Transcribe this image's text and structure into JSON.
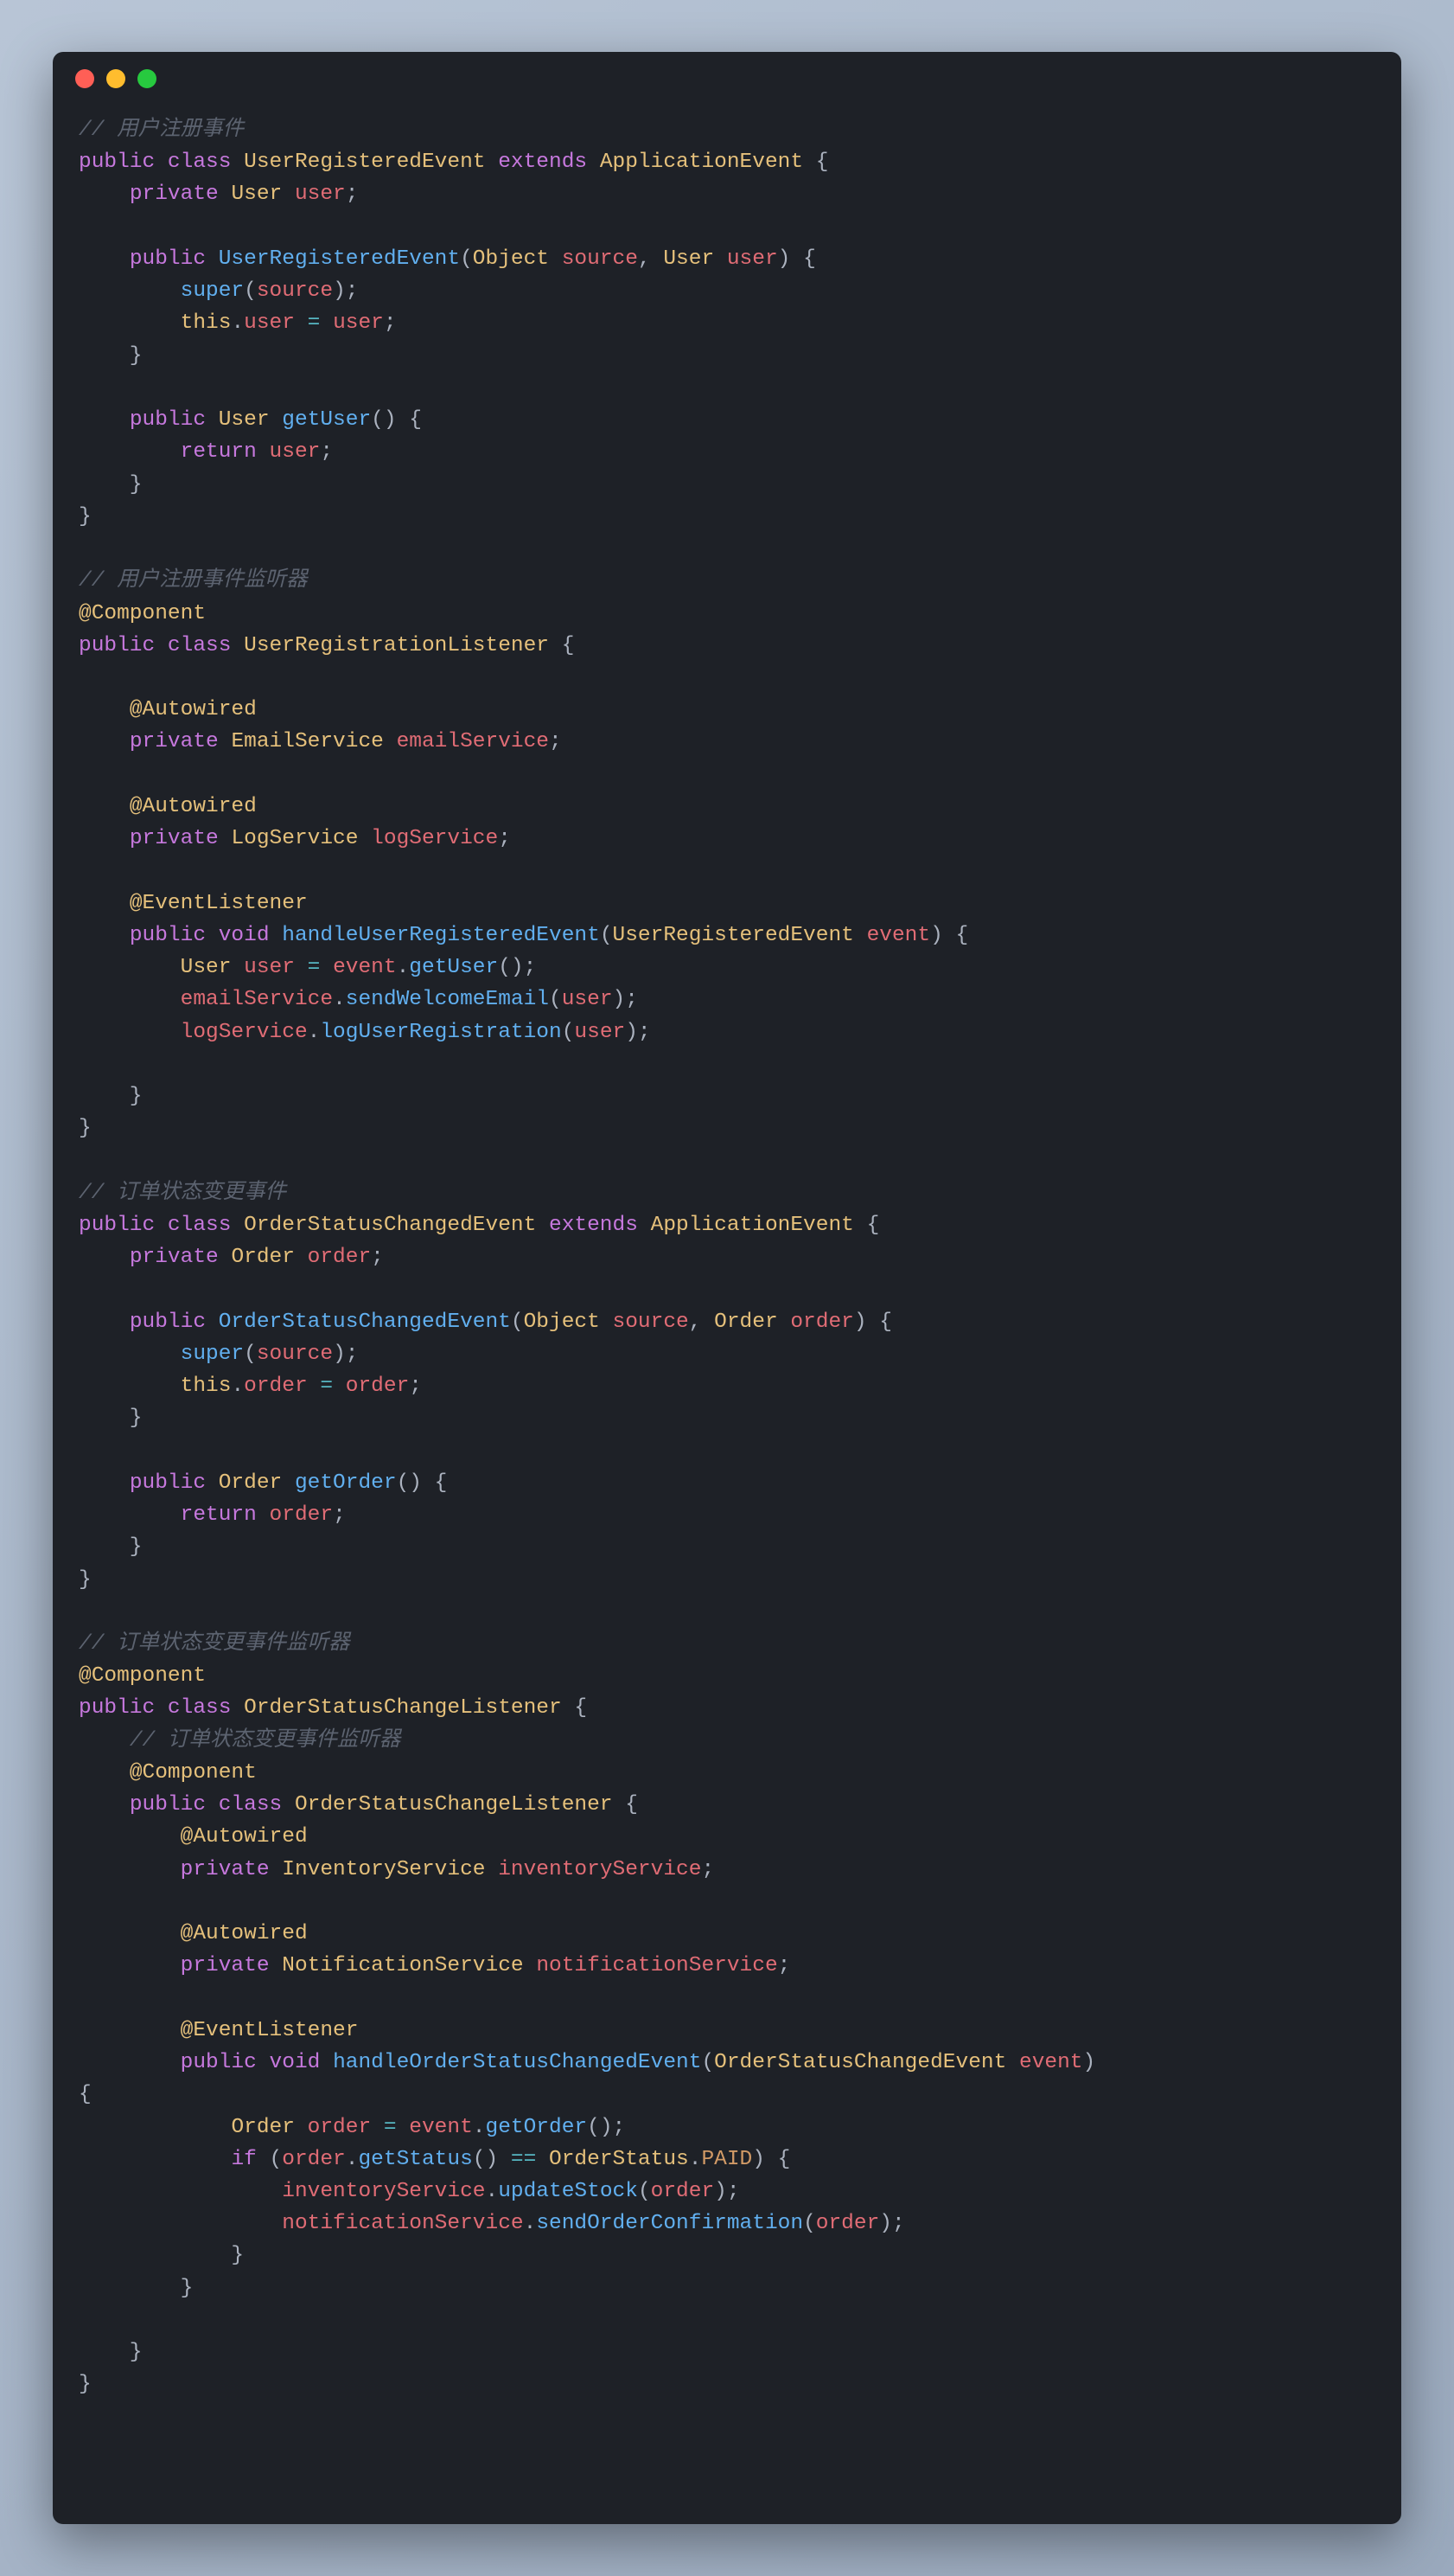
{
  "window": {
    "traffic_lights": [
      "red",
      "yellow",
      "green"
    ]
  },
  "code": {
    "lines": [
      [
        [
          "c-comment",
          "// 用户注册事件"
        ]
      ],
      [
        [
          "c-keyword",
          "public"
        ],
        [
          "c-plain",
          " "
        ],
        [
          "c-keyword",
          "class"
        ],
        [
          "c-plain",
          " "
        ],
        [
          "c-type",
          "UserRegisteredEvent"
        ],
        [
          "c-plain",
          " "
        ],
        [
          "c-keyword",
          "extends"
        ],
        [
          "c-plain",
          " "
        ],
        [
          "c-type",
          "ApplicationEvent"
        ],
        [
          "c-plain",
          " {"
        ]
      ],
      [
        [
          "c-plain",
          "    "
        ],
        [
          "c-keyword",
          "private"
        ],
        [
          "c-plain",
          " "
        ],
        [
          "c-type",
          "User"
        ],
        [
          "c-plain",
          " "
        ],
        [
          "c-var",
          "user"
        ],
        [
          "c-plain",
          ";"
        ]
      ],
      [
        [
          "c-plain",
          ""
        ]
      ],
      [
        [
          "c-plain",
          "    "
        ],
        [
          "c-keyword",
          "public"
        ],
        [
          "c-plain",
          " "
        ],
        [
          "c-method",
          "UserRegisteredEvent"
        ],
        [
          "c-plain",
          "("
        ],
        [
          "c-type",
          "Object"
        ],
        [
          "c-plain",
          " "
        ],
        [
          "c-var",
          "source"
        ],
        [
          "c-plain",
          ", "
        ],
        [
          "c-type",
          "User"
        ],
        [
          "c-plain",
          " "
        ],
        [
          "c-var",
          "user"
        ],
        [
          "c-plain",
          ") {"
        ]
      ],
      [
        [
          "c-plain",
          "        "
        ],
        [
          "c-method",
          "super"
        ],
        [
          "c-plain",
          "("
        ],
        [
          "c-var",
          "source"
        ],
        [
          "c-plain",
          ");"
        ]
      ],
      [
        [
          "c-plain",
          "        "
        ],
        [
          "c-this",
          "this"
        ],
        [
          "c-plain",
          "."
        ],
        [
          "c-var",
          "user"
        ],
        [
          "c-plain",
          " "
        ],
        [
          "c-op",
          "="
        ],
        [
          "c-plain",
          " "
        ],
        [
          "c-var",
          "user"
        ],
        [
          "c-plain",
          ";"
        ]
      ],
      [
        [
          "c-plain",
          "    }"
        ]
      ],
      [
        [
          "c-plain",
          ""
        ]
      ],
      [
        [
          "c-plain",
          "    "
        ],
        [
          "c-keyword",
          "public"
        ],
        [
          "c-plain",
          " "
        ],
        [
          "c-type",
          "User"
        ],
        [
          "c-plain",
          " "
        ],
        [
          "c-method",
          "getUser"
        ],
        [
          "c-plain",
          "() {"
        ]
      ],
      [
        [
          "c-plain",
          "        "
        ],
        [
          "c-keyword",
          "return"
        ],
        [
          "c-plain",
          " "
        ],
        [
          "c-var",
          "user"
        ],
        [
          "c-plain",
          ";"
        ]
      ],
      [
        [
          "c-plain",
          "    }"
        ]
      ],
      [
        [
          "c-plain",
          "}"
        ]
      ],
      [
        [
          "c-plain",
          ""
        ]
      ],
      [
        [
          "c-comment",
          "// 用户注册事件监听器"
        ]
      ],
      [
        [
          "c-ann",
          "@Component"
        ]
      ],
      [
        [
          "c-keyword",
          "public"
        ],
        [
          "c-plain",
          " "
        ],
        [
          "c-keyword",
          "class"
        ],
        [
          "c-plain",
          " "
        ],
        [
          "c-type",
          "UserRegistrationListener"
        ],
        [
          "c-plain",
          " {"
        ]
      ],
      [
        [
          "c-plain",
          ""
        ]
      ],
      [
        [
          "c-plain",
          "    "
        ],
        [
          "c-ann",
          "@Autowired"
        ]
      ],
      [
        [
          "c-plain",
          "    "
        ],
        [
          "c-keyword",
          "private"
        ],
        [
          "c-plain",
          " "
        ],
        [
          "c-type",
          "EmailService"
        ],
        [
          "c-plain",
          " "
        ],
        [
          "c-var",
          "emailService"
        ],
        [
          "c-plain",
          ";"
        ]
      ],
      [
        [
          "c-plain",
          ""
        ]
      ],
      [
        [
          "c-plain",
          "    "
        ],
        [
          "c-ann",
          "@Autowired"
        ]
      ],
      [
        [
          "c-plain",
          "    "
        ],
        [
          "c-keyword",
          "private"
        ],
        [
          "c-plain",
          " "
        ],
        [
          "c-type",
          "LogService"
        ],
        [
          "c-plain",
          " "
        ],
        [
          "c-var",
          "logService"
        ],
        [
          "c-plain",
          ";"
        ]
      ],
      [
        [
          "c-plain",
          ""
        ]
      ],
      [
        [
          "c-plain",
          "    "
        ],
        [
          "c-ann",
          "@EventListener"
        ]
      ],
      [
        [
          "c-plain",
          "    "
        ],
        [
          "c-keyword",
          "public"
        ],
        [
          "c-plain",
          " "
        ],
        [
          "c-keyword",
          "void"
        ],
        [
          "c-plain",
          " "
        ],
        [
          "c-method",
          "handleUserRegisteredEvent"
        ],
        [
          "c-plain",
          "("
        ],
        [
          "c-type",
          "UserRegisteredEvent"
        ],
        [
          "c-plain",
          " "
        ],
        [
          "c-var",
          "event"
        ],
        [
          "c-plain",
          ") {"
        ]
      ],
      [
        [
          "c-plain",
          "        "
        ],
        [
          "c-type",
          "User"
        ],
        [
          "c-plain",
          " "
        ],
        [
          "c-var",
          "user"
        ],
        [
          "c-plain",
          " "
        ],
        [
          "c-op",
          "="
        ],
        [
          "c-plain",
          " "
        ],
        [
          "c-var",
          "event"
        ],
        [
          "c-plain",
          "."
        ],
        [
          "c-method",
          "getUser"
        ],
        [
          "c-plain",
          "();"
        ]
      ],
      [
        [
          "c-plain",
          "        "
        ],
        [
          "c-var",
          "emailService"
        ],
        [
          "c-plain",
          "."
        ],
        [
          "c-method",
          "sendWelcomeEmail"
        ],
        [
          "c-plain",
          "("
        ],
        [
          "c-var",
          "user"
        ],
        [
          "c-plain",
          ");"
        ]
      ],
      [
        [
          "c-plain",
          "        "
        ],
        [
          "c-var",
          "logService"
        ],
        [
          "c-plain",
          "."
        ],
        [
          "c-method",
          "logUserRegistration"
        ],
        [
          "c-plain",
          "("
        ],
        [
          "c-var",
          "user"
        ],
        [
          "c-plain",
          ");"
        ]
      ],
      [
        [
          "c-plain",
          ""
        ]
      ],
      [
        [
          "c-plain",
          "    }"
        ]
      ],
      [
        [
          "c-plain",
          "}"
        ]
      ],
      [
        [
          "c-plain",
          ""
        ]
      ],
      [
        [
          "c-comment",
          "// 订单状态变更事件"
        ]
      ],
      [
        [
          "c-keyword",
          "public"
        ],
        [
          "c-plain",
          " "
        ],
        [
          "c-keyword",
          "class"
        ],
        [
          "c-plain",
          " "
        ],
        [
          "c-type",
          "OrderStatusChangedEvent"
        ],
        [
          "c-plain",
          " "
        ],
        [
          "c-keyword",
          "extends"
        ],
        [
          "c-plain",
          " "
        ],
        [
          "c-type",
          "ApplicationEvent"
        ],
        [
          "c-plain",
          " {"
        ]
      ],
      [
        [
          "c-plain",
          "    "
        ],
        [
          "c-keyword",
          "private"
        ],
        [
          "c-plain",
          " "
        ],
        [
          "c-type",
          "Order"
        ],
        [
          "c-plain",
          " "
        ],
        [
          "c-var",
          "order"
        ],
        [
          "c-plain",
          ";"
        ]
      ],
      [
        [
          "c-plain",
          ""
        ]
      ],
      [
        [
          "c-plain",
          "    "
        ],
        [
          "c-keyword",
          "public"
        ],
        [
          "c-plain",
          " "
        ],
        [
          "c-method",
          "OrderStatusChangedEvent"
        ],
        [
          "c-plain",
          "("
        ],
        [
          "c-type",
          "Object"
        ],
        [
          "c-plain",
          " "
        ],
        [
          "c-var",
          "source"
        ],
        [
          "c-plain",
          ", "
        ],
        [
          "c-type",
          "Order"
        ],
        [
          "c-plain",
          " "
        ],
        [
          "c-var",
          "order"
        ],
        [
          "c-plain",
          ") {"
        ]
      ],
      [
        [
          "c-plain",
          "        "
        ],
        [
          "c-method",
          "super"
        ],
        [
          "c-plain",
          "("
        ],
        [
          "c-var",
          "source"
        ],
        [
          "c-plain",
          ");"
        ]
      ],
      [
        [
          "c-plain",
          "        "
        ],
        [
          "c-this",
          "this"
        ],
        [
          "c-plain",
          "."
        ],
        [
          "c-var",
          "order"
        ],
        [
          "c-plain",
          " "
        ],
        [
          "c-op",
          "="
        ],
        [
          "c-plain",
          " "
        ],
        [
          "c-var",
          "order"
        ],
        [
          "c-plain",
          ";"
        ]
      ],
      [
        [
          "c-plain",
          "    }"
        ]
      ],
      [
        [
          "c-plain",
          ""
        ]
      ],
      [
        [
          "c-plain",
          "    "
        ],
        [
          "c-keyword",
          "public"
        ],
        [
          "c-plain",
          " "
        ],
        [
          "c-type",
          "Order"
        ],
        [
          "c-plain",
          " "
        ],
        [
          "c-method",
          "getOrder"
        ],
        [
          "c-plain",
          "() {"
        ]
      ],
      [
        [
          "c-plain",
          "        "
        ],
        [
          "c-keyword",
          "return"
        ],
        [
          "c-plain",
          " "
        ],
        [
          "c-var",
          "order"
        ],
        [
          "c-plain",
          ";"
        ]
      ],
      [
        [
          "c-plain",
          "    }"
        ]
      ],
      [
        [
          "c-plain",
          "}"
        ]
      ],
      [
        [
          "c-plain",
          ""
        ]
      ],
      [
        [
          "c-comment",
          "// 订单状态变更事件监听器"
        ]
      ],
      [
        [
          "c-ann",
          "@Component"
        ]
      ],
      [
        [
          "c-keyword",
          "public"
        ],
        [
          "c-plain",
          " "
        ],
        [
          "c-keyword",
          "class"
        ],
        [
          "c-plain",
          " "
        ],
        [
          "c-type",
          "OrderStatusChangeListener"
        ],
        [
          "c-plain",
          " {"
        ]
      ],
      [
        [
          "c-plain",
          "    "
        ],
        [
          "c-comment",
          "// 订单状态变更事件监听器"
        ]
      ],
      [
        [
          "c-plain",
          "    "
        ],
        [
          "c-ann",
          "@Component"
        ]
      ],
      [
        [
          "c-plain",
          "    "
        ],
        [
          "c-keyword",
          "public"
        ],
        [
          "c-plain",
          " "
        ],
        [
          "c-keyword",
          "class"
        ],
        [
          "c-plain",
          " "
        ],
        [
          "c-type",
          "OrderStatusChangeListener"
        ],
        [
          "c-plain",
          " {"
        ]
      ],
      [
        [
          "c-plain",
          "        "
        ],
        [
          "c-ann",
          "@Autowired"
        ]
      ],
      [
        [
          "c-plain",
          "        "
        ],
        [
          "c-keyword",
          "private"
        ],
        [
          "c-plain",
          " "
        ],
        [
          "c-type",
          "InventoryService"
        ],
        [
          "c-plain",
          " "
        ],
        [
          "c-var",
          "inventoryService"
        ],
        [
          "c-plain",
          ";"
        ]
      ],
      [
        [
          "c-plain",
          ""
        ]
      ],
      [
        [
          "c-plain",
          "        "
        ],
        [
          "c-ann",
          "@Autowired"
        ]
      ],
      [
        [
          "c-plain",
          "        "
        ],
        [
          "c-keyword",
          "private"
        ],
        [
          "c-plain",
          " "
        ],
        [
          "c-type",
          "NotificationService"
        ],
        [
          "c-plain",
          " "
        ],
        [
          "c-var",
          "notificationService"
        ],
        [
          "c-plain",
          ";"
        ]
      ],
      [
        [
          "c-plain",
          ""
        ]
      ],
      [
        [
          "c-plain",
          "        "
        ],
        [
          "c-ann",
          "@EventListener"
        ]
      ],
      [
        [
          "c-plain",
          "        "
        ],
        [
          "c-keyword",
          "public"
        ],
        [
          "c-plain",
          " "
        ],
        [
          "c-keyword",
          "void"
        ],
        [
          "c-plain",
          " "
        ],
        [
          "c-method",
          "handleOrderStatusChangedEvent"
        ],
        [
          "c-plain",
          "("
        ],
        [
          "c-type",
          "OrderStatusChangedEvent"
        ],
        [
          "c-plain",
          " "
        ],
        [
          "c-var",
          "event"
        ],
        [
          "c-plain",
          ") "
        ]
      ],
      [
        [
          "c-plain",
          "{"
        ]
      ],
      [
        [
          "c-plain",
          "            "
        ],
        [
          "c-type",
          "Order"
        ],
        [
          "c-plain",
          " "
        ],
        [
          "c-var",
          "order"
        ],
        [
          "c-plain",
          " "
        ],
        [
          "c-op",
          "="
        ],
        [
          "c-plain",
          " "
        ],
        [
          "c-var",
          "event"
        ],
        [
          "c-plain",
          "."
        ],
        [
          "c-method",
          "getOrder"
        ],
        [
          "c-plain",
          "();"
        ]
      ],
      [
        [
          "c-plain",
          "            "
        ],
        [
          "c-keyword",
          "if"
        ],
        [
          "c-plain",
          " ("
        ],
        [
          "c-var",
          "order"
        ],
        [
          "c-plain",
          "."
        ],
        [
          "c-method",
          "getStatus"
        ],
        [
          "c-plain",
          "() "
        ],
        [
          "c-op",
          "=="
        ],
        [
          "c-plain",
          " "
        ],
        [
          "c-type",
          "OrderStatus"
        ],
        [
          "c-plain",
          "."
        ],
        [
          "c-const",
          "PAID"
        ],
        [
          "c-plain",
          ") {"
        ]
      ],
      [
        [
          "c-plain",
          "                "
        ],
        [
          "c-var",
          "inventoryService"
        ],
        [
          "c-plain",
          "."
        ],
        [
          "c-method",
          "updateStock"
        ],
        [
          "c-plain",
          "("
        ],
        [
          "c-var",
          "order"
        ],
        [
          "c-plain",
          ");"
        ]
      ],
      [
        [
          "c-plain",
          "                "
        ],
        [
          "c-var",
          "notificationService"
        ],
        [
          "c-plain",
          "."
        ],
        [
          "c-method",
          "sendOrderConfirmation"
        ],
        [
          "c-plain",
          "("
        ],
        [
          "c-var",
          "order"
        ],
        [
          "c-plain",
          ");"
        ]
      ],
      [
        [
          "c-plain",
          "            }"
        ]
      ],
      [
        [
          "c-plain",
          "        }"
        ]
      ],
      [
        [
          "c-plain",
          ""
        ]
      ],
      [
        [
          "c-plain",
          "    }"
        ]
      ],
      [
        [
          "c-plain",
          "}"
        ]
      ]
    ]
  }
}
